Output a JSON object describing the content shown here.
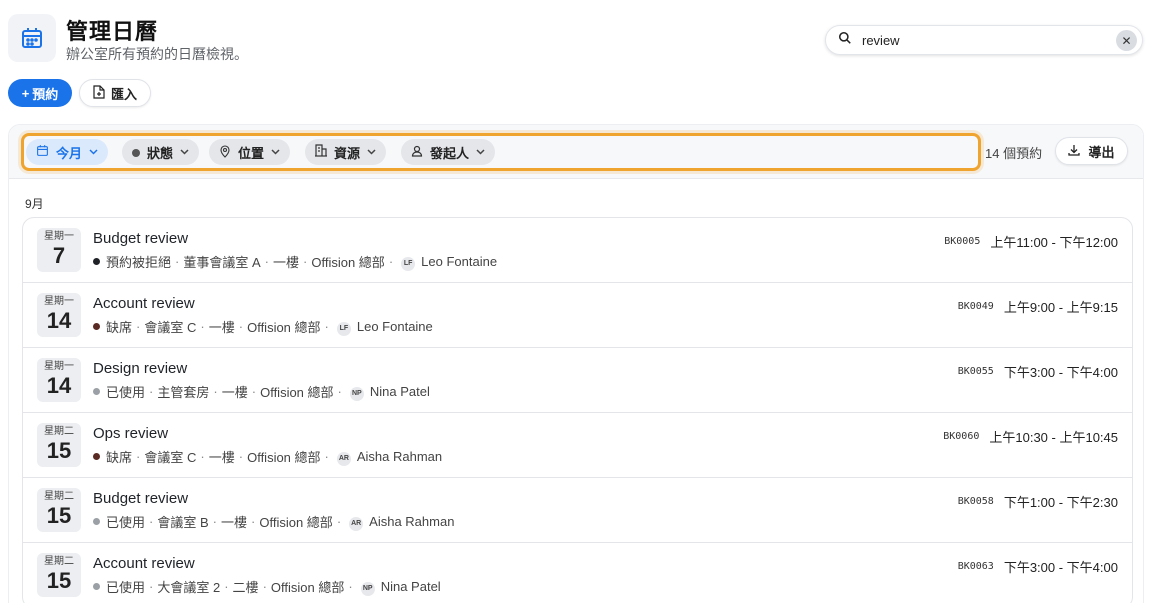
{
  "header": {
    "title": "管理日曆",
    "subtitle": "辦公室所有預約的日曆檢視。"
  },
  "search": {
    "value": "review",
    "clear_symbol": "✕"
  },
  "actions": {
    "new_label": "預約",
    "new_symbol": "+",
    "import_label": "匯入"
  },
  "filters": [
    {
      "label": "今月",
      "icon": "calendar-icon",
      "active": true
    },
    {
      "label": "狀態",
      "icon": "dot-icon",
      "active": false
    },
    {
      "label": "位置",
      "icon": "location-pin-icon",
      "active": false
    },
    {
      "label": "資源",
      "icon": "building-icon",
      "active": false
    },
    {
      "label": "發起人",
      "icon": "person-icon",
      "active": false
    }
  ],
  "toolbar": {
    "count": "14 個預約",
    "export_label": "導出"
  },
  "month_label": "9月",
  "bookings": [
    {
      "weekday": "星期一",
      "day": "7",
      "title": "Budget review",
      "status": "預約被拒絕",
      "room": "董事會議室 A",
      "floor": "一樓",
      "office": "Offision 總部",
      "initials": "LF",
      "person": "Leo Fontaine",
      "code": "BK0005",
      "time": "上午11:00 - 下午12:00"
    },
    {
      "weekday": "星期一",
      "day": "14",
      "title": "Account review",
      "status": "缺席",
      "room": "會議室 C",
      "floor": "一樓",
      "office": "Offision 總部",
      "initials": "LF",
      "person": "Leo Fontaine",
      "code": "BK0049",
      "time": "上午9:00 - 上午9:15"
    },
    {
      "weekday": "星期一",
      "day": "14",
      "title": "Design review",
      "status": "已使用",
      "room": "主管套房",
      "floor": "一樓",
      "office": "Offision 總部",
      "initials": "NP",
      "person": "Nina Patel",
      "code": "BK0055",
      "time": "下午3:00 - 下午4:00"
    },
    {
      "weekday": "星期二",
      "day": "15",
      "title": "Ops review",
      "status": "缺席",
      "room": "會議室 C",
      "floor": "一樓",
      "office": "Offision 總部",
      "initials": "AR",
      "person": "Aisha Rahman",
      "code": "BK0060",
      "time": "上午10:30 - 上午10:45"
    },
    {
      "weekday": "星期二",
      "day": "15",
      "title": "Budget review",
      "status": "已使用",
      "room": "會議室 B",
      "floor": "一樓",
      "office": "Offision 總部",
      "initials": "AR",
      "person": "Aisha Rahman",
      "code": "BK0058",
      "time": "下午1:00 - 下午2:30"
    },
    {
      "weekday": "星期二",
      "day": "15",
      "title": "Account review",
      "status": "已使用",
      "room": "大會議室 2",
      "floor": "二樓",
      "office": "Offision 總部",
      "initials": "NP",
      "person": "Nina Patel",
      "code": "BK0063",
      "time": "下午3:00 - 下午4:00"
    }
  ],
  "colors": {
    "accent": "#1a73e8",
    "focus_ring": "#f0a430",
    "status_rejected": "#1f2328",
    "status_noshow": "#5a2a24",
    "status_used": "#9aa0a6"
  }
}
